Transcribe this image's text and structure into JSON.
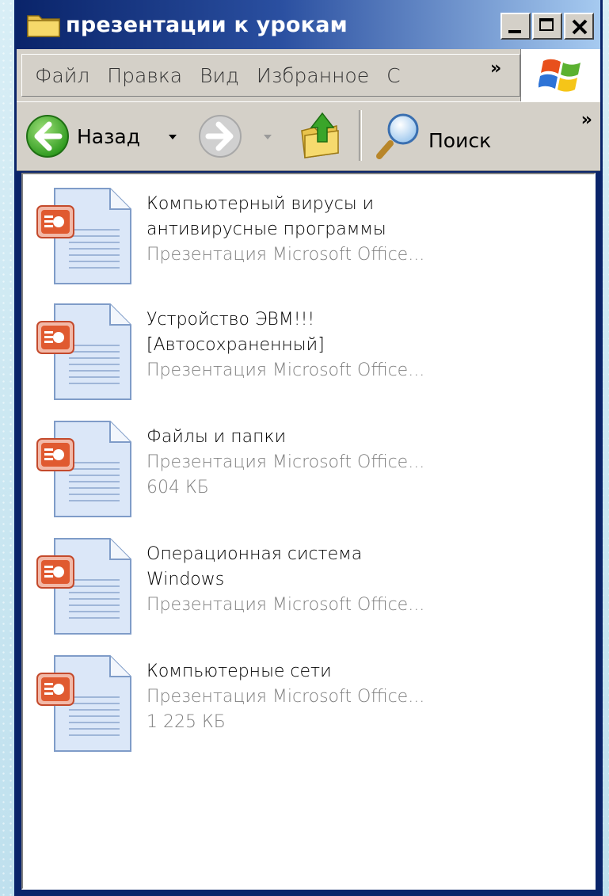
{
  "window": {
    "title": "презентации к урокам",
    "title_icon": "folder-icon",
    "buttons": [
      "minimize",
      "maximize",
      "close"
    ]
  },
  "menu": {
    "items": [
      "Файл",
      "Правка",
      "Вид",
      "Избранное",
      "С"
    ],
    "overflow": "»"
  },
  "toolbar": {
    "back_label": "Назад",
    "search_label": "Поиск",
    "overflow": "»"
  },
  "files": [
    {
      "name_lines": [
        "Компьютерный вирусы и",
        "антивирусные программы"
      ],
      "type": "Презентация Microsoft Office...",
      "size": ""
    },
    {
      "name_lines": [
        "Устройство ЭВМ!!!",
        "[Автосохраненный]"
      ],
      "type": "Презентация Microsoft Office...",
      "size": ""
    },
    {
      "name_lines": [
        "Файлы и папки"
      ],
      "type": "Презентация Microsoft Office...",
      "size": "604 КБ"
    },
    {
      "name_lines": [
        "Операционная система",
        "Windows"
      ],
      "type": "Презентация Microsoft Office...",
      "size": ""
    },
    {
      "name_lines": [
        "Компьютерные сети"
      ],
      "type": "Презентация Microsoft Office...",
      "size": "1 225 КБ"
    }
  ],
  "colors": {
    "titlebar_start": "#0a246a",
    "titlebar_end": "#a6caf0",
    "chrome": "#d4d0c8",
    "secondary_text": "#7f7f7f"
  }
}
